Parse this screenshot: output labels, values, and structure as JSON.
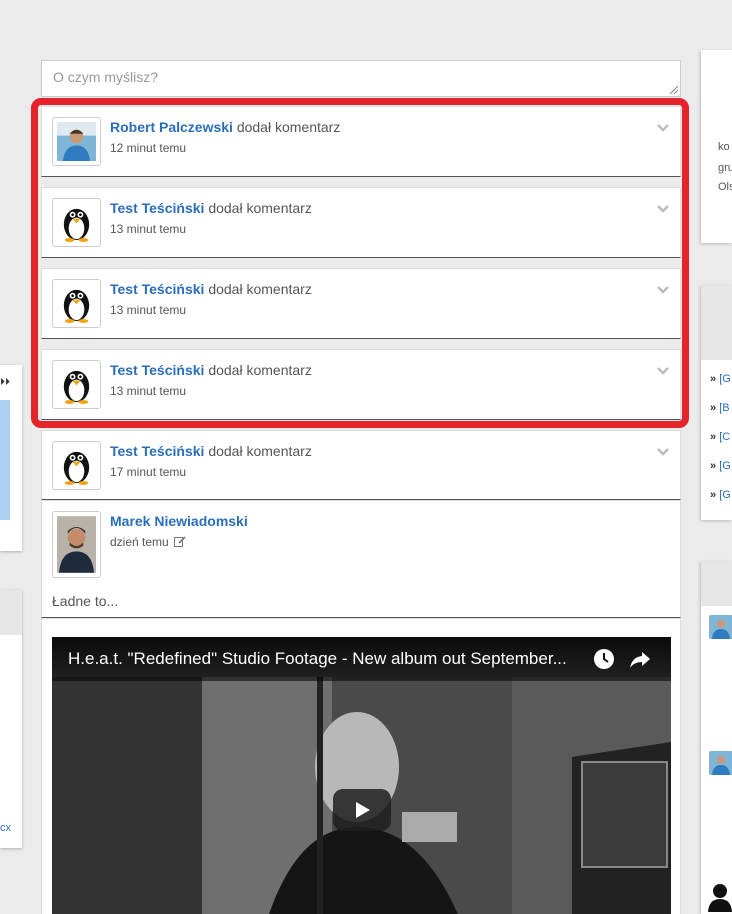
{
  "composer": {
    "placeholder": "O czym myślisz?"
  },
  "feed": [
    {
      "author": "Robert Palczewski",
      "action": "dodał komentarz",
      "time": "12 minut temu",
      "avatar": "photo-man-blue-shirt"
    },
    {
      "author": "Test Teściński",
      "action": "dodał komentarz",
      "time": "13 minut temu",
      "avatar": "penguin-icon"
    },
    {
      "author": "Test Teściński",
      "action": "dodał komentarz",
      "time": "13 minut temu",
      "avatar": "penguin-icon"
    },
    {
      "author": "Test Teściński",
      "action": "dodał komentarz",
      "time": "13 minut temu",
      "avatar": "penguin-icon"
    },
    {
      "author": "Test Teściński",
      "action": "dodał komentarz",
      "time": "17 minut temu",
      "avatar": "penguin-icon"
    }
  ],
  "post": {
    "author": "Marek Niewiadomski",
    "time": "dzień temu",
    "text": "Ładne to..."
  },
  "video": {
    "title": "H.e.a.t. \"Redefined\" Studio Footage - New album out September..."
  },
  "right_panel_1": {
    "lines": [
      "ko",
      "gru",
      "Ols"
    ]
  },
  "right_panel_2": {
    "items": [
      "[G",
      "[B",
      "[C",
      "[G",
      "[G"
    ],
    "bullet": "»"
  },
  "left_panel": {
    "link": "cx",
    "nav": "⏵⏵"
  },
  "colors": {
    "highlight": "#e5232a",
    "link": "#2a6ebb"
  }
}
